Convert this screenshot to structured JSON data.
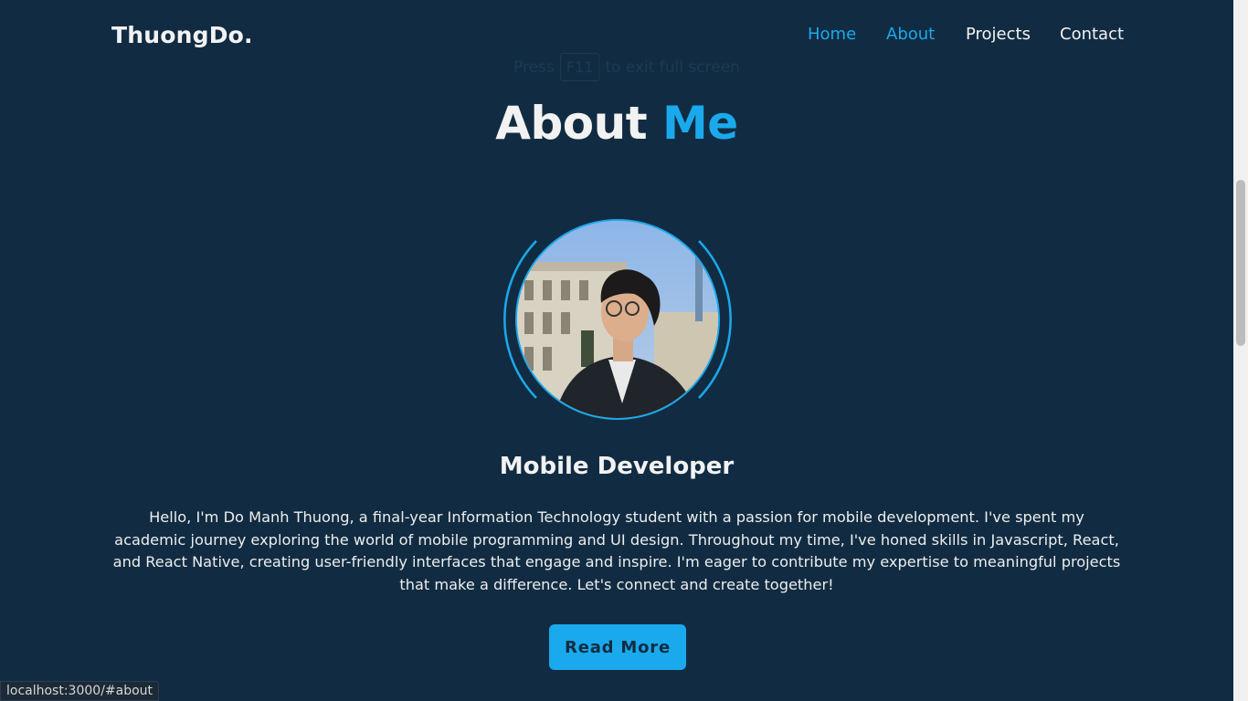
{
  "header": {
    "logo": "ThuongDo.",
    "nav": [
      {
        "label": "Home",
        "active": true
      },
      {
        "label": "About",
        "active": true
      },
      {
        "label": "Projects",
        "active": false
      },
      {
        "label": "Contact",
        "active": false
      }
    ]
  },
  "fullscreen_hint": {
    "prefix": "Press",
    "key": "F11",
    "suffix": "to exit full screen"
  },
  "about": {
    "heading_main": "About",
    "heading_accent": "Me",
    "subtitle": "Mobile Developer",
    "bio": "Hello, I'm Do Manh Thuong, a final-year Information Technology student with a passion for mobile development. I've spent my academic journey exploring the world of mobile programming and UI design. Throughout my time, I've honed skills in Javascript, React, and React Native, creating user-friendly interfaces that engage and inspire. I'm eager to contribute my expertise to meaningful projects that make a difference. Let's connect and create together!",
    "button_label": "Read More"
  },
  "status_bar": {
    "url": "localhost:3000/#about"
  },
  "colors": {
    "background": "#112c42",
    "accent": "#1aa9ec",
    "text": "#ededed"
  },
  "icons": {
    "avatar": "profile-photo"
  }
}
